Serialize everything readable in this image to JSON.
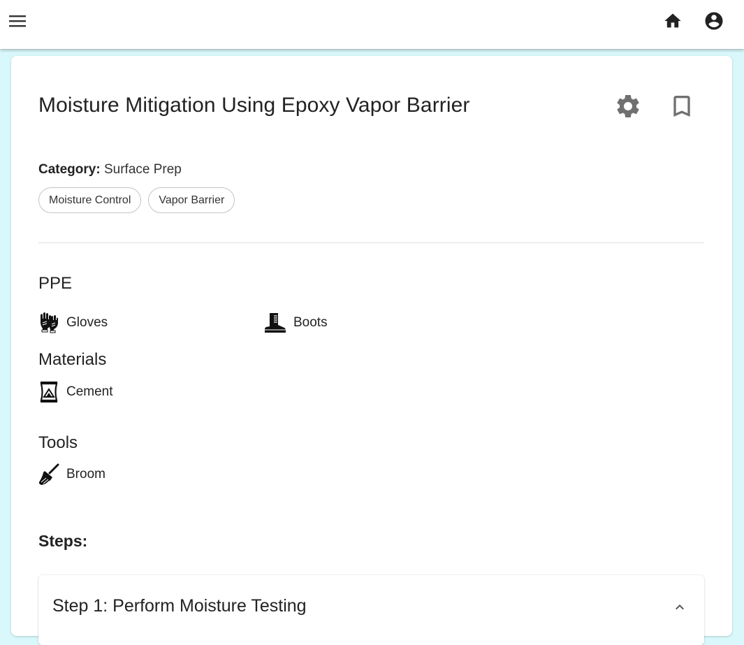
{
  "topbar": {
    "menu_icon": "menu-icon",
    "home_icon": "home-icon",
    "account_icon": "account-circle-icon"
  },
  "guide": {
    "title": "Moisture Mitigation Using Epoxy Vapor Barrier",
    "settings_icon": "gear-icon",
    "bookmark_icon": "bookmark-outline-icon",
    "category_label": "Category:",
    "category_value": "Surface Prep",
    "tags": [
      "Moisture Control",
      "Vapor Barrier"
    ]
  },
  "ppe": {
    "title": "PPE",
    "items": [
      {
        "label": "Gloves",
        "icon": "gloves-icon"
      },
      {
        "label": "Boots",
        "icon": "boot-icon"
      }
    ]
  },
  "materials": {
    "title": "Materials",
    "items": [
      {
        "label": "Cement",
        "icon": "cement-bag-icon"
      }
    ]
  },
  "tools": {
    "title": "Tools",
    "items": [
      {
        "label": "Broom",
        "icon": "broom-icon"
      }
    ]
  },
  "steps": {
    "title": "Steps:",
    "items": [
      {
        "title": "Step 1: Perform Moisture Testing",
        "expanded": true
      }
    ]
  }
}
